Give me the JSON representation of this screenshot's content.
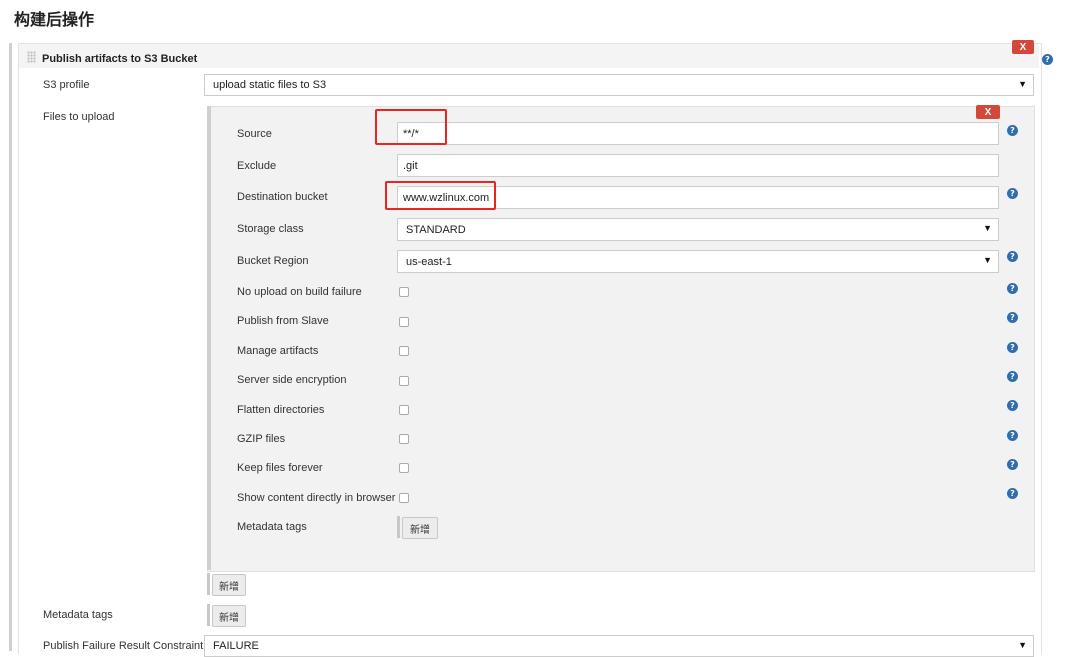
{
  "section_title": "构建后操作",
  "plugin": {
    "title": "Publish artifacts to S3 Bucket",
    "remove_label": "X"
  },
  "s3_profile": {
    "label": "S3 profile",
    "value": "upload static files to S3"
  },
  "files_to_upload": {
    "label": "Files to upload",
    "remove_label": "X",
    "source": {
      "label": "Source",
      "value": "**/*"
    },
    "exclude": {
      "label": "Exclude",
      "value": ".git"
    },
    "destination_bucket": {
      "label": "Destination bucket",
      "value": "www.wzlinux.com"
    },
    "storage_class": {
      "label": "Storage class",
      "value": "STANDARD"
    },
    "bucket_region": {
      "label": "Bucket Region",
      "value": "us-east-1"
    },
    "options": [
      {
        "label": "No upload on build failure",
        "checked": false
      },
      {
        "label": "Publish from Slave",
        "checked": false
      },
      {
        "label": "Manage artifacts",
        "checked": false
      },
      {
        "label": "Server side encryption",
        "checked": false
      },
      {
        "label": "Flatten directories",
        "checked": false
      },
      {
        "label": "GZIP files",
        "checked": false
      },
      {
        "label": "Keep files forever",
        "checked": false
      },
      {
        "label": "Show content directly in browser",
        "checked": false
      }
    ],
    "metadata_tags": {
      "label": "Metadata tags",
      "add_label": "新增"
    },
    "add_label": "新增"
  },
  "metadata_tags": {
    "label": "Metadata tags",
    "add_label": "新增"
  },
  "publish_failure": {
    "label": "Publish Failure Result Constraint",
    "value": "FAILURE"
  },
  "help_icon_glyph": "?",
  "caret_glyph": "▼",
  "colors": {
    "remove_button": "#d24939",
    "help_icon": "#2f6fad",
    "highlight_box": "#e8261f"
  }
}
